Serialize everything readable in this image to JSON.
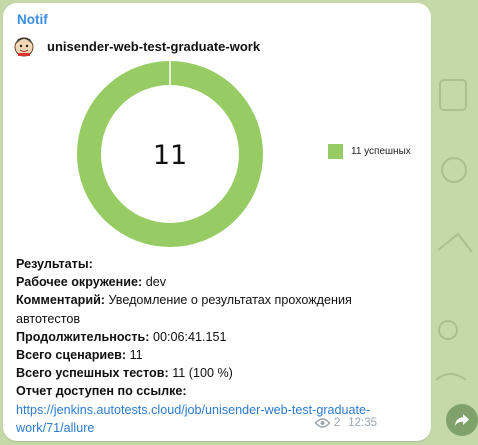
{
  "message": {
    "sender": "Notif",
    "report_title": "unisender-web-test-graduate-work",
    "donut": {
      "total_label": "11",
      "passed": 11,
      "total": 11,
      "color": "#97cc64"
    },
    "legend": {
      "label": "11 успешных",
      "color": "#97cc64"
    },
    "results_heading": "Результаты:",
    "environment_label": "Рабочее окружение:",
    "environment_value": "dev",
    "comment_label": "Комментарий:",
    "comment_value_line1": "Уведомление о результатах прохождения",
    "comment_value_line2": "автотестов",
    "duration_label": "Продолжительность:",
    "duration_value": "00:06:41.151",
    "scenarios_label": "Всего сценариев:",
    "scenarios_value": "11",
    "passed_label": "Всего успешных тестов:",
    "passed_value": "11 (100 %)",
    "report_link_label": "Отчет доступен по ссылке:",
    "report_link_line1": "https://jenkins.autotests.cloud/job/unisender-web-test-graduate-",
    "report_link_line2": "work/71/allure",
    "views": "2",
    "time": "12:35"
  },
  "colors": {
    "link": "#2b7bd3",
    "sender": "#3a8ee0",
    "chat_background": "#c5d8a8"
  },
  "icons": [
    "jenkins-avatar-icon",
    "eye-icon",
    "share-arrow-icon"
  ]
}
